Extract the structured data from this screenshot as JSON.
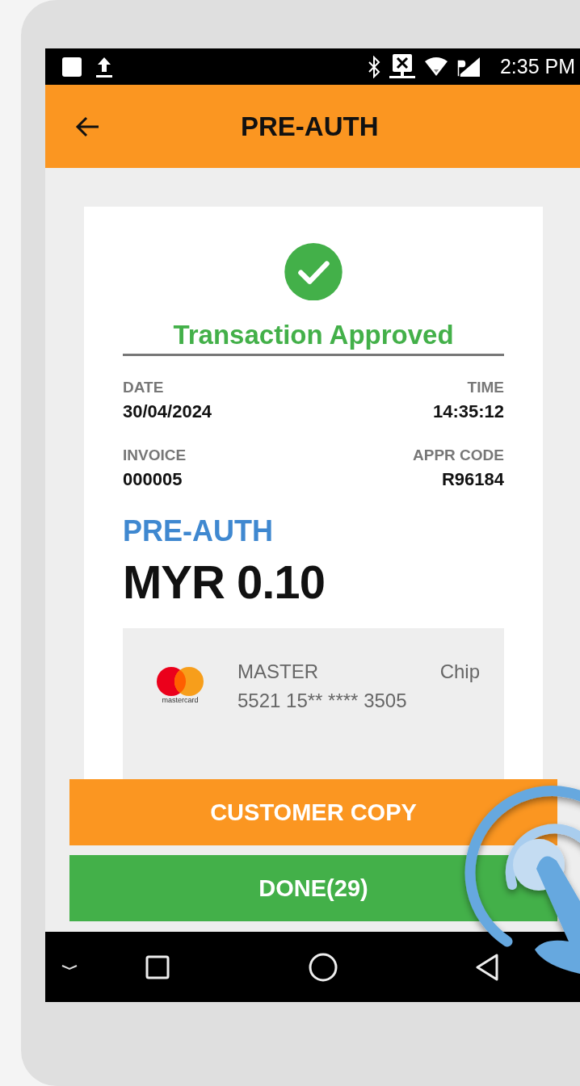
{
  "status_bar": {
    "time": "2:35 PM"
  },
  "app_bar": {
    "title": "PRE-AUTH"
  },
  "receipt": {
    "status": "Transaction Approved",
    "fields": [
      {
        "label": "DATE",
        "value": "30/04/2024"
      },
      {
        "label": "TIME",
        "value": "14:35:12"
      },
      {
        "label": "INVOICE",
        "value": "000005"
      },
      {
        "label": "APPR CODE",
        "value": "R96184"
      }
    ],
    "transaction_type": "PRE-AUTH",
    "amount": "MYR 0.10",
    "card": {
      "brand_mark": "mastercard",
      "brand": "MASTER",
      "entry_mode": "Chip",
      "number": "5521 15** **** 3505"
    }
  },
  "buttons": [
    {
      "label": "CUSTOMER COPY",
      "kind": "secondary"
    },
    {
      "label": "DONE(29)",
      "kind": "primary"
    }
  ]
}
